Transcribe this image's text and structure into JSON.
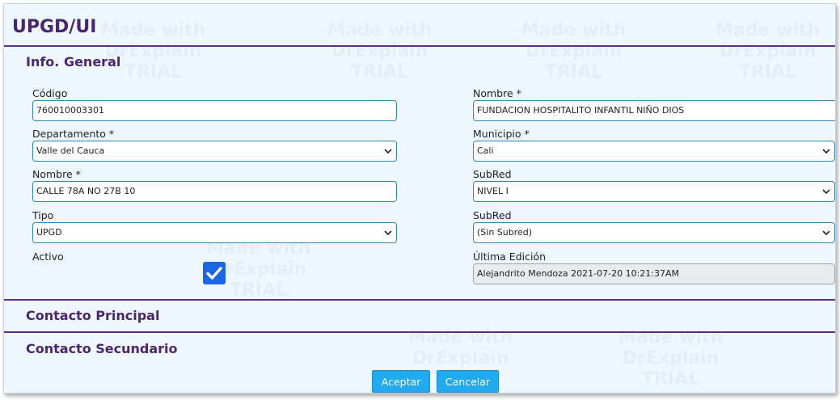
{
  "page": {
    "title": "UPGD/UI"
  },
  "watermark": {
    "line1": "Made with",
    "line2": "DrExplain",
    "line3": "TRIAL"
  },
  "info_general": {
    "title": "Info. General",
    "codigo": {
      "label": "Código",
      "value": "760010003301"
    },
    "nombre_entidad": {
      "label": "Nombre *",
      "value": "FUNDACION HOSPITALITO INFANTIL NIÑO DIOS"
    },
    "departamento": {
      "label": "Departamento *",
      "value": "Valle del Cauca"
    },
    "municipio": {
      "label": "Municipio *",
      "value": "Cali"
    },
    "nombre_direccion": {
      "label": "Nombre *",
      "value": "CALLE 78A NO 27B 10"
    },
    "subred_nivel": {
      "label": "SubRed",
      "value": "NIVEL I"
    },
    "tipo": {
      "label": "Tipo",
      "value": "UPGD"
    },
    "subred": {
      "label": "SubRed",
      "value": "(Sin Subred)"
    },
    "activo": {
      "label": "Activo",
      "checked": true
    },
    "ultima_edicion": {
      "label": "Última Edición",
      "value": "Alejandrito Mendoza 2021-07-20 10:21:37AM"
    }
  },
  "contacto_principal": {
    "title": "Contacto Principal"
  },
  "contacto_secundario": {
    "title": "Contacto Secundario"
  },
  "actions": {
    "accept_label": "Aceptar",
    "cancel_label": "Cancelar"
  },
  "colors": {
    "accent": "#4a2670",
    "divider": "#5b2c83",
    "button": "#22aaf0",
    "checkbox": "#1a66e6",
    "input_border": "#2f86b5"
  }
}
